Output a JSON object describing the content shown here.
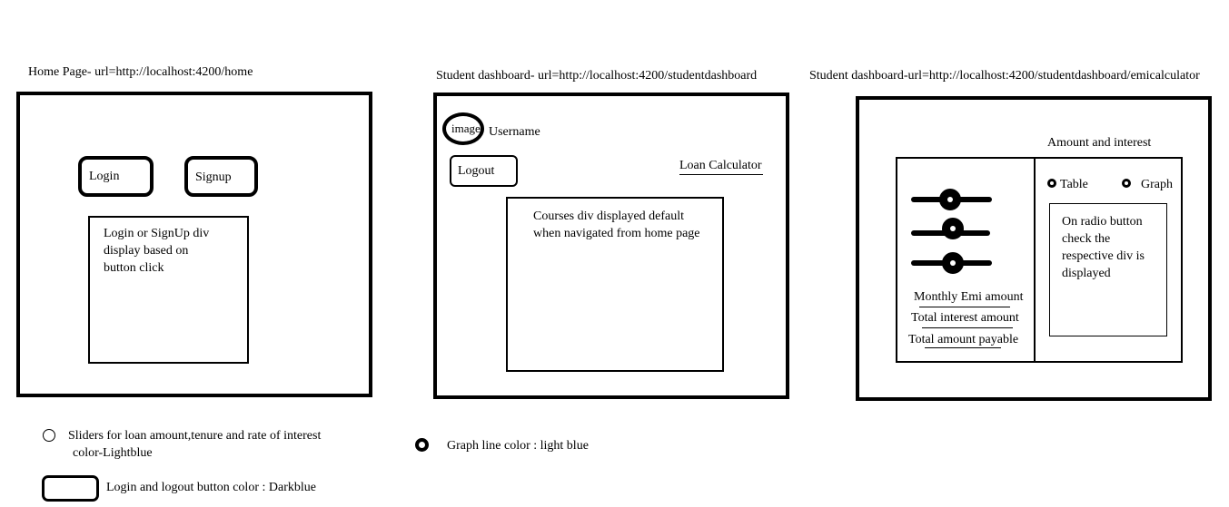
{
  "home": {
    "caption": "Home Page- url=http://localhost:4200/home",
    "login_label": "Login",
    "signup_label": "Signup",
    "panel_text": "Login or SignUp div display based on button click"
  },
  "dashboard": {
    "caption": "Student dashboard- url=http://localhost:4200/studentdashboard",
    "avatar_label": "image",
    "username": "Username",
    "logout_label": "Logout",
    "loan_link": "Loan Calculator",
    "courses_text": "Courses div displayed default when navigated from home page"
  },
  "emi": {
    "caption": "Student dashboard-url=http://localhost:4200/studentdashboard/emicalculator",
    "section_title": "Amount and interest",
    "results": [
      "Monthly Emi amount",
      "Total interest amount",
      "Total amount payable"
    ],
    "radio_table": "Table",
    "radio_graph": "Graph",
    "result_panel_text": "On radio button check the respective div is displayed"
  },
  "legend": {
    "sliders_line1": "Sliders for loan amount,tenure and rate of interest",
    "sliders_line2": "color-Lightblue",
    "graph_line": "Graph line color : light blue",
    "button_color": "Login and logout button color : Darkblue"
  }
}
